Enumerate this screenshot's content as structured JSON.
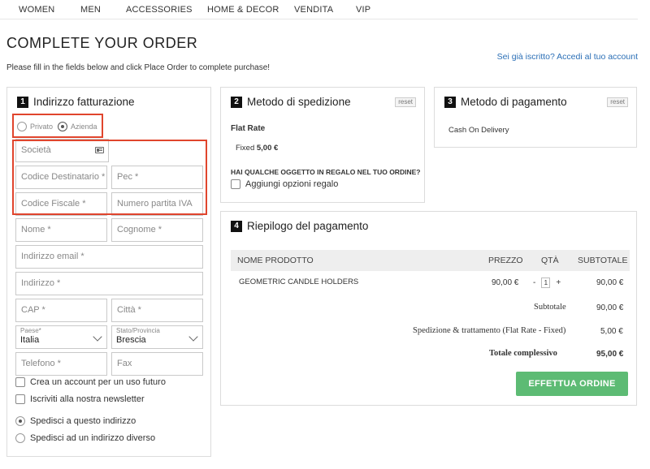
{
  "nav": {
    "items": [
      "WOMEN",
      "MEN",
      "ACCESSORIES",
      "HOME & DECOR",
      "VENDITA",
      "VIP"
    ]
  },
  "page": {
    "title": "COMPLETE YOUR ORDER",
    "subtitle": "Please fill in the fields below and click Place Order to complete purchase!",
    "login_link": "Sei già iscritto? Accedi al tuo account"
  },
  "billing": {
    "step": "1",
    "title": "Indirizzo fatturazione",
    "type_options": [
      "Privato",
      "Azienda"
    ],
    "type_selected": "Azienda",
    "fields": {
      "company": "Società",
      "recipient_code": "Codice Destinatario *",
      "pec": "Pec *",
      "fiscal_code": "Codice Fiscale *",
      "vat": "Numero partita IVA",
      "first_name": "Nome *",
      "last_name": "Cognome *",
      "email": "Indirizzo email *",
      "address": "Indirizzo *",
      "zip": "CAP *",
      "city": "Città *",
      "phone": "Telefono *",
      "fax": "Fax"
    },
    "country": {
      "label": "Paese*",
      "value": "Italia"
    },
    "province": {
      "label": "Stato/Provincia",
      "value": "Brescia"
    },
    "checkbox_account": "Crea un account per un uso futuro",
    "checkbox_newsletter": "Iscriviti alla nostra newsletter",
    "ship_same": "Spedisci a questo indirizzo",
    "ship_different": "Spedisci ad un indirizzo diverso"
  },
  "shipping": {
    "step": "2",
    "title": "Metodo di spedizione",
    "reset": "reset",
    "method": "Flat Rate",
    "fixed_label": "Fixed",
    "fixed_price": "5,00 €",
    "gift_question": "HAI QUALCHE OGGETTO IN REGALO NEL TUO ORDINE?",
    "gift_option": "Aggiungi opzioni regalo"
  },
  "payment": {
    "step": "3",
    "title": "Metodo di pagamento",
    "reset": "reset",
    "method": "Cash On Delivery"
  },
  "summary": {
    "step": "4",
    "title": "Riepilogo del pagamento",
    "headers": {
      "product": "NOME PRODOTTO",
      "price": "PREZZO",
      "qty": "QTÀ",
      "subtotal": "SUBTOTALE"
    },
    "items": [
      {
        "name": "GEOMETRIC CANDLE HOLDERS",
        "price": "90,00 €",
        "qty": "1",
        "subtotal": "90,00 €"
      }
    ],
    "qty_minus": "-",
    "qty_plus": "+",
    "subtotal_label": "Subtotale",
    "subtotal_value": "90,00 €",
    "shipping_label": "Spedizione & trattamento (Flat Rate - Fixed)",
    "shipping_value": "5,00 €",
    "total_label": "Totale complessivo",
    "total_value": "95,00 €",
    "cta": "EFFETTUA ORDINE"
  },
  "colors": {
    "accent_link": "#2b6fb6",
    "cta_green": "#5dbb74",
    "highlight_red": "#e0452d"
  }
}
